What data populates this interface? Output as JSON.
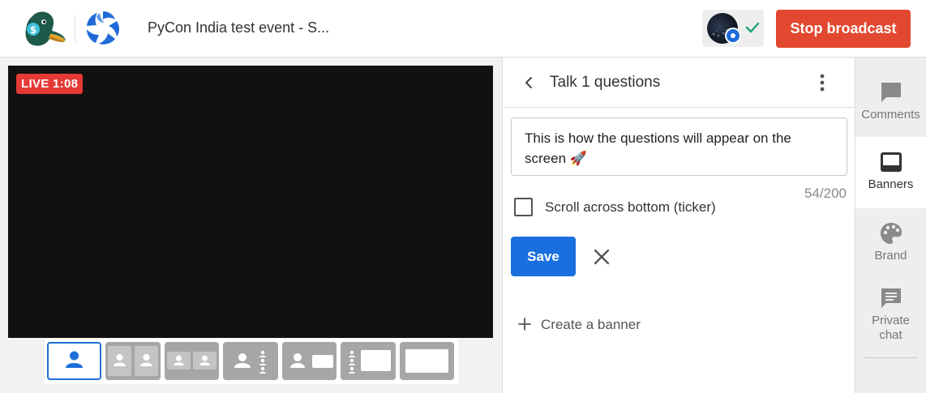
{
  "header": {
    "event_title": "PyCon India test event - S...",
    "stop_broadcast_label": "Stop broadcast"
  },
  "stage": {
    "live_badge": "LIVE 1:08"
  },
  "layouts": [
    {
      "name": "solo",
      "active": true
    },
    {
      "name": "split-two"
    },
    {
      "name": "thin-split"
    },
    {
      "name": "group"
    },
    {
      "name": "leader-screen"
    },
    {
      "name": "small-screen"
    },
    {
      "name": "full-screen"
    }
  ],
  "panel": {
    "title": "Talk 1 questions",
    "banner_text": "This is how the questions will appear on the screen 🚀",
    "counter": "54/200",
    "ticker_label": "Scroll across bottom (ticker)",
    "save_label": "Save",
    "create_banner_label": "Create a banner"
  },
  "sidenav": {
    "items": [
      {
        "label": "Comments",
        "icon": "comment-icon"
      },
      {
        "label": "Banners",
        "icon": "banner-icon",
        "active": true
      },
      {
        "label": "Brand",
        "icon": "palette-icon"
      },
      {
        "label": "Private chat",
        "icon": "chat-icon"
      }
    ]
  },
  "colors": {
    "accent": "#1a6fe0",
    "stop": "#e2482f",
    "live": "#e53935",
    "check": "#1aa37a"
  }
}
